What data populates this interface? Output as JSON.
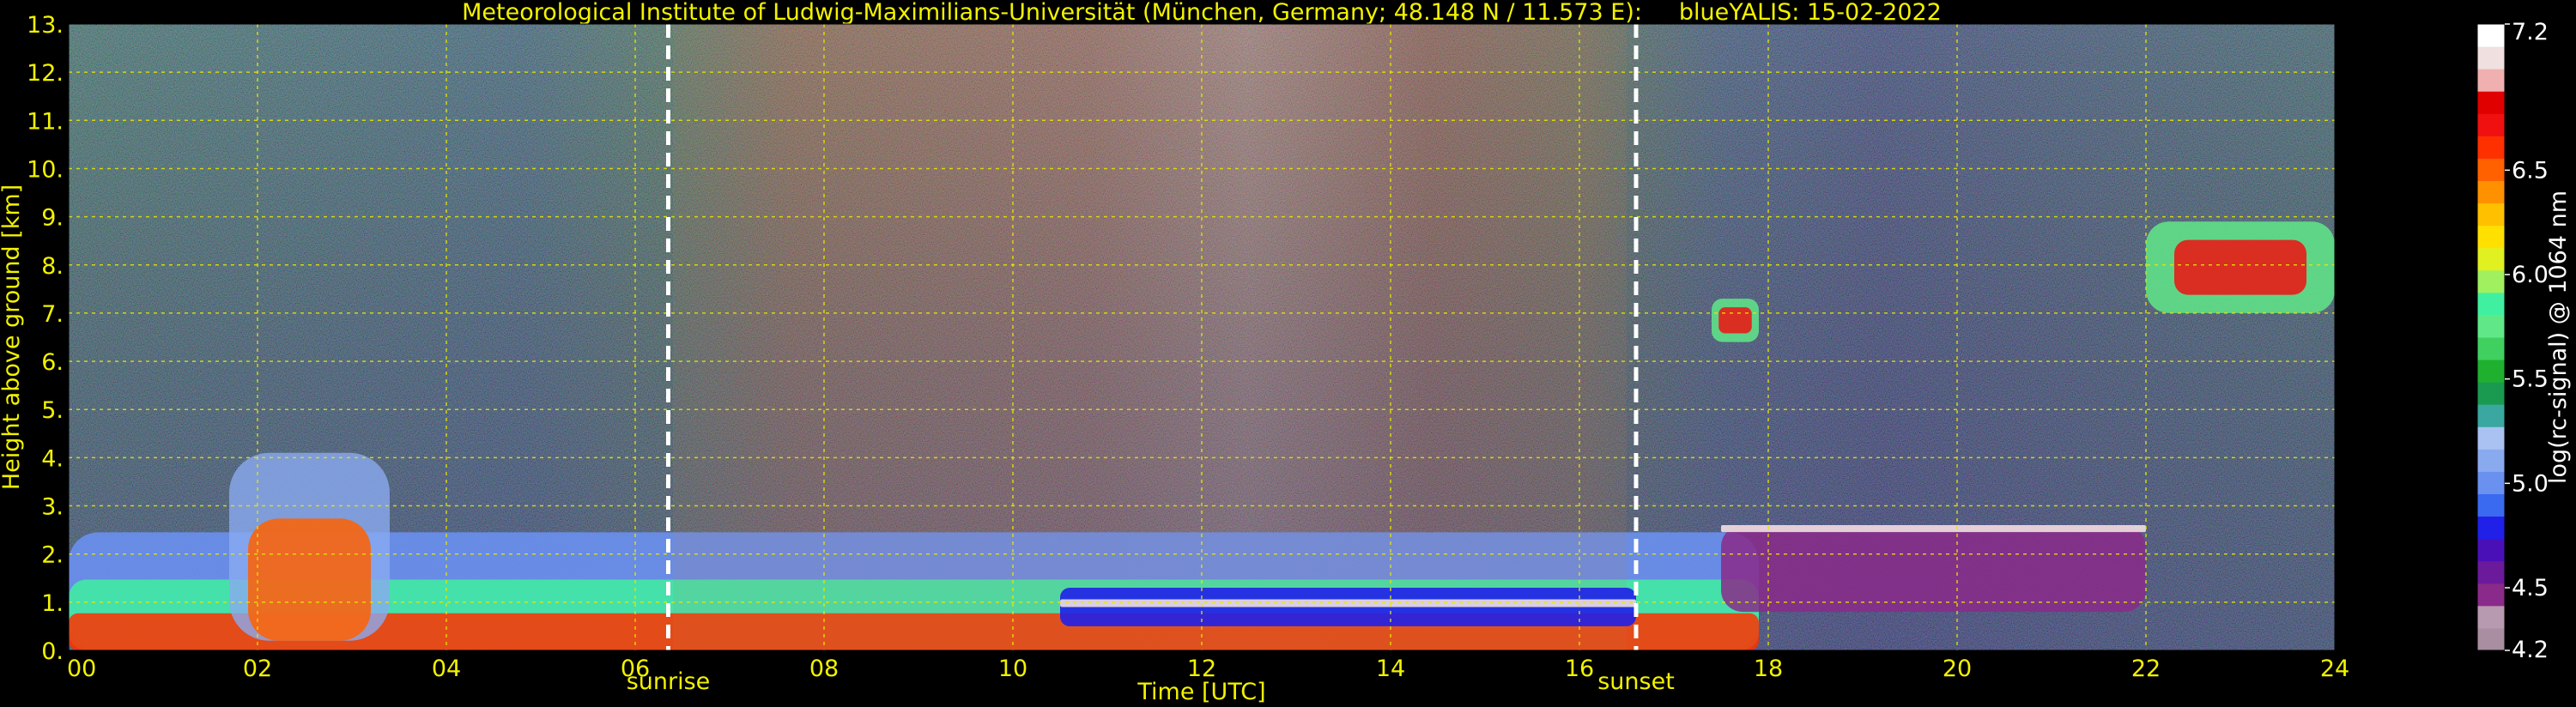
{
  "chart_data": {
    "type": "heatmap",
    "title": "Meteorological Institute of Ludwig-Maximilians-Universität (München, Germany; 48.148 N / 11.573 E):     blueYALIS: 15-02-2022",
    "xlabel": "Time [UTC]",
    "ylabel": "Height above ground [km]",
    "xlim": [
      0,
      24
    ],
    "ylim": [
      0,
      13
    ],
    "x_ticks": [
      "00",
      "02",
      "04",
      "06",
      "08",
      "10",
      "12",
      "14",
      "16",
      "18",
      "20",
      "22",
      "24"
    ],
    "y_ticks": [
      "0.",
      "1.",
      "2.",
      "3.",
      "4.",
      "5.",
      "6.",
      "7.",
      "8.",
      "9.",
      "10.",
      "11.",
      "12.",
      "13."
    ],
    "grid": true,
    "events": [
      {
        "label": "sunrise",
        "time": 6.35
      },
      {
        "label": "sunset",
        "time": 16.6
      }
    ],
    "colorbar": {
      "label": "log(rc-signal) @ 1064 nm",
      "range": [
        4.2,
        7.2
      ],
      "ticks": [
        "4.2",
        "4.5",
        "5.0",
        "5.5",
        "6.0",
        "6.5",
        "7.2"
      ],
      "tick_values": [
        4.2,
        4.5,
        5.0,
        5.5,
        6.0,
        6.5,
        7.2
      ],
      "colors": [
        "#a88ea0",
        "#b89ab0",
        "#8a2a8a",
        "#6a1a9a",
        "#4a10b8",
        "#2020e8",
        "#3a6af0",
        "#6a90f0",
        "#8aaaf0",
        "#aac2f2",
        "#3aa8a0",
        "#1a9a50",
        "#20b030",
        "#40d060",
        "#60e888",
        "#40f0a0",
        "#a0f060",
        "#e0f020",
        "#ffe000",
        "#ffc000",
        "#ff9000",
        "#ff6000",
        "#ff3000",
        "#f01010",
        "#e00000",
        "#f0b0b0",
        "#f0e0e0",
        "#ffffff"
      ]
    },
    "features": [
      {
        "kind": "boundary_layer_aerosol",
        "time_range": [
          0,
          17.9
        ],
        "height_range_km": [
          0,
          3.5
        ]
      },
      {
        "kind": "convective_plumes",
        "time_range": [
          1.7,
          3.4
        ],
        "height_range_km": [
          0.2,
          4.1
        ]
      },
      {
        "kind": "daytime_background_noise",
        "time_range": [
          6.4,
          16.5
        ],
        "height_range_km": [
          0,
          13
        ]
      },
      {
        "kind": "low_cloud_layer",
        "time_range": [
          10.5,
          16.6
        ],
        "height_range_km": [
          0.5,
          1.3
        ]
      },
      {
        "kind": "elevated_layer",
        "time_range": [
          17.5,
          22
        ],
        "height_range_km": [
          0.8,
          2.6
        ]
      },
      {
        "kind": "cirrus_cloud",
        "time_range": [
          17.4,
          17.9
        ],
        "height_range_km": [
          6.4,
          7.3
        ]
      },
      {
        "kind": "cirrus_cloud",
        "time_range": [
          22,
          24
        ],
        "height_range_km": [
          7.0,
          8.9
        ]
      }
    ]
  }
}
